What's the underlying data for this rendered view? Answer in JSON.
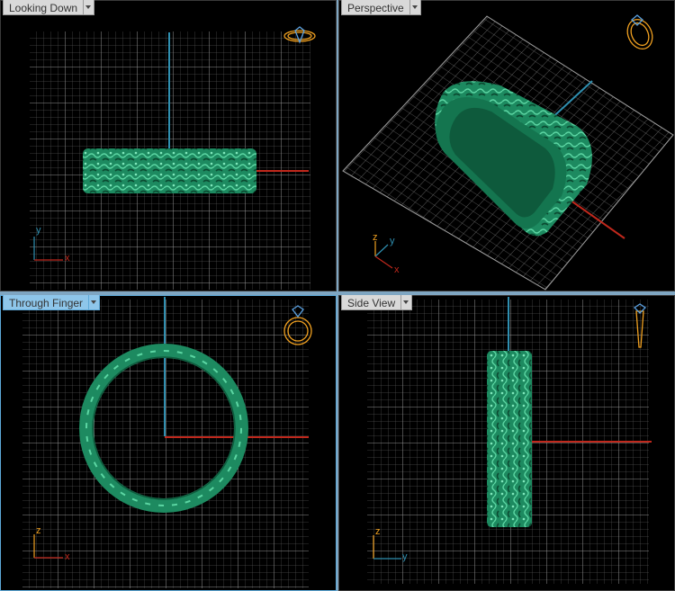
{
  "viewports": [
    {
      "id": "top-left",
      "label": "Looking Down",
      "active": false
    },
    {
      "id": "top-right",
      "label": "Perspective",
      "active": false
    },
    {
      "id": "bottom-left",
      "label": "Through Finger",
      "active": true
    },
    {
      "id": "bottom-right",
      "label": "Side View",
      "active": false
    }
  ],
  "axes": {
    "looking_down": {
      "vertical": "y",
      "horizontal": "x"
    },
    "perspective": {
      "a": "z",
      "b": "y",
      "c": "x"
    },
    "through_finger": {
      "vertical": "z",
      "horizontal": "x"
    },
    "side_view": {
      "vertical": "z",
      "horizontal": "y"
    }
  },
  "colors": {
    "grid": "#8a8a8a",
    "ring": "#1e8a62",
    "ring_dark": "#0f5a3d",
    "axis_x": "#c0281c",
    "axis_y": "#2f8fb0",
    "gizmo": "#f0a020",
    "active_label": "#8ec6ea"
  }
}
